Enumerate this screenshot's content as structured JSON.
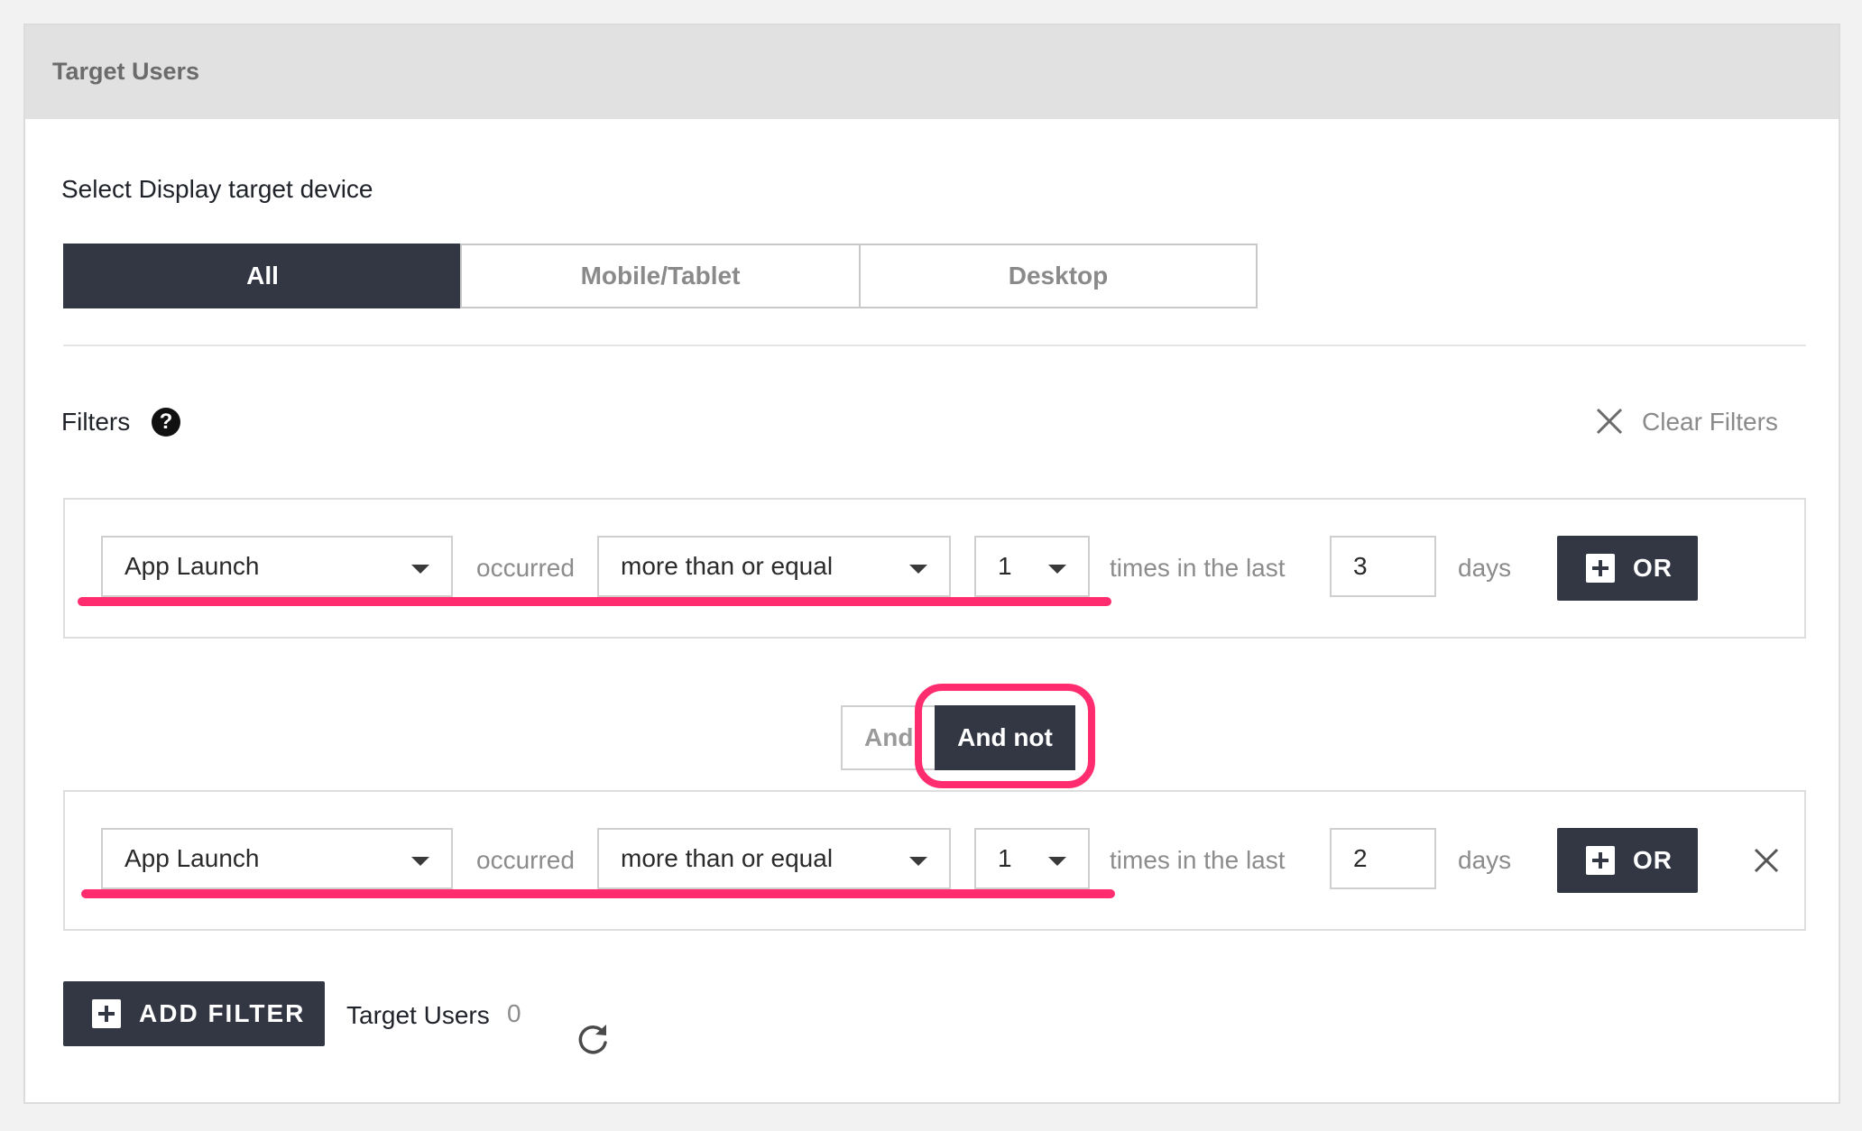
{
  "panel": {
    "title": "Target Users"
  },
  "device": {
    "label": "Select Display target device",
    "options": [
      "All",
      "Mobile/Tablet",
      "Desktop"
    ],
    "selected": "All"
  },
  "filters": {
    "label": "Filters",
    "help_icon": "question-circle-icon",
    "clear_label": "Clear Filters",
    "rows": [
      {
        "event": "App Launch",
        "occurred_text": "occurred",
        "operator": "more than or equal",
        "count": "1",
        "times_text": "times in the last",
        "days_value": "3",
        "days_text": "days",
        "or_label": "OR"
      },
      {
        "event": "App Launch",
        "occurred_text": "occurred",
        "operator": "more than or equal",
        "count": "1",
        "times_text": "times in the last",
        "days_value": "2",
        "days_text": "days",
        "or_label": "OR"
      }
    ],
    "joiner": {
      "and_label": "And",
      "and_not_label": "And not",
      "selected": "And not"
    }
  },
  "footer": {
    "add_filter_label": "ADD FILTER",
    "target_users_label": "Target Users",
    "target_users_count": "0"
  },
  "colors": {
    "accent_dark": "#333744",
    "highlight": "#ff2d6f",
    "header_bg": "#e1e1e1"
  }
}
